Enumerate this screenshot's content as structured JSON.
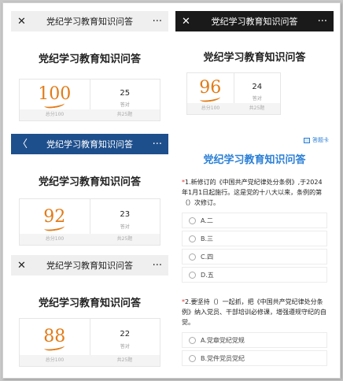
{
  "shots": [
    {
      "app_title": "党纪学习教育知识问答",
      "page_title": "党纪学习教育知识问答",
      "score": "100",
      "correct": "25",
      "correct_label": "答对",
      "total_label": "总分100",
      "count_label": "共25题"
    },
    {
      "app_title": "党纪学习教育知识问答",
      "page_title": "党纪学习教育知识问答",
      "score": "96",
      "correct": "24",
      "correct_label": "答对",
      "total_label": "总分100",
      "count_label": "共25题"
    },
    {
      "app_title": "党纪学习教育知识问答",
      "page_title": "党纪学习教育知识问答",
      "score": "92",
      "correct": "23",
      "correct_label": "答对",
      "total_label": "总分100",
      "count_label": "共25题"
    },
    {
      "app_title": "党纪学习教育知识问答",
      "page_title": "党纪学习教育知识问答",
      "score": "88",
      "correct": "22",
      "correct_label": "答对",
      "total_label": "总分100",
      "count_label": "共25题"
    }
  ],
  "quiz": {
    "answer_card_label": "答题卡",
    "title": "党纪学习教育知识问答",
    "q1": {
      "text": "1.新修订的《中国共产党纪律处分条例》,于2024年1月1日起施行。这是党的十八大以来，条例的第（）次修订。",
      "options": [
        "A.二",
        "B.三",
        "C.四",
        "D.五"
      ]
    },
    "q2": {
      "text": "2.要坚持（）一起抓，把《中国共产党纪律处分条例》纳入党员、干部培训必修课，增强遵规守纪的自觉。",
      "options": [
        "A.党章党纪党规",
        "B.党件党员党纪"
      ]
    }
  },
  "icons": {
    "close": "close-icon",
    "more": "more-icon",
    "back": "back-icon"
  },
  "colors": {
    "accent": "#e27b17",
    "blue_bar": "#1e4f8d",
    "quiz_blue": "#2a7fd6"
  }
}
